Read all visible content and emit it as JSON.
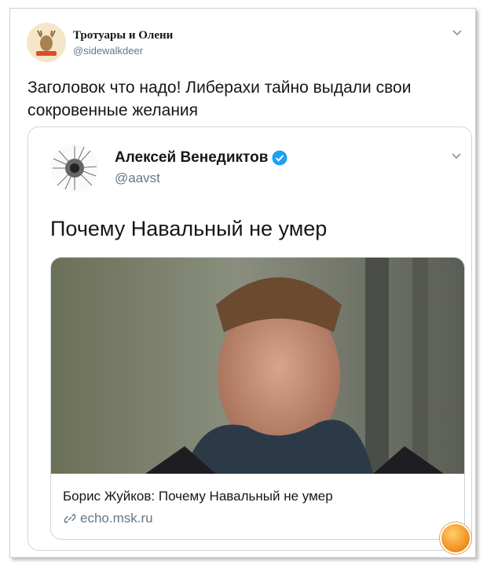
{
  "outer_tweet": {
    "author_name": "Тротуары и Олени",
    "author_handle": "@sidewalkdeer",
    "text": "Заголовок что надо! Либерахи тайно выдали свои сокровенные желания",
    "menu_icon": "chevron-down-icon"
  },
  "quoted_tweet": {
    "author_name": "Алексей Венедиктов",
    "author_handle": "@aavst",
    "verified_icon": "verified-badge-icon",
    "text": "Почему Навальный не умер",
    "menu_icon": "chevron-down-icon"
  },
  "link_preview": {
    "title": "Борис Жуйков: Почему Навальный не умер",
    "domain": "echo.msk.ru",
    "link_icon": "link-icon"
  },
  "colors": {
    "text_primary": "#14171a",
    "text_secondary": "#657786",
    "border": "#ccd6dd",
    "verified_blue": "#1da1f2"
  }
}
